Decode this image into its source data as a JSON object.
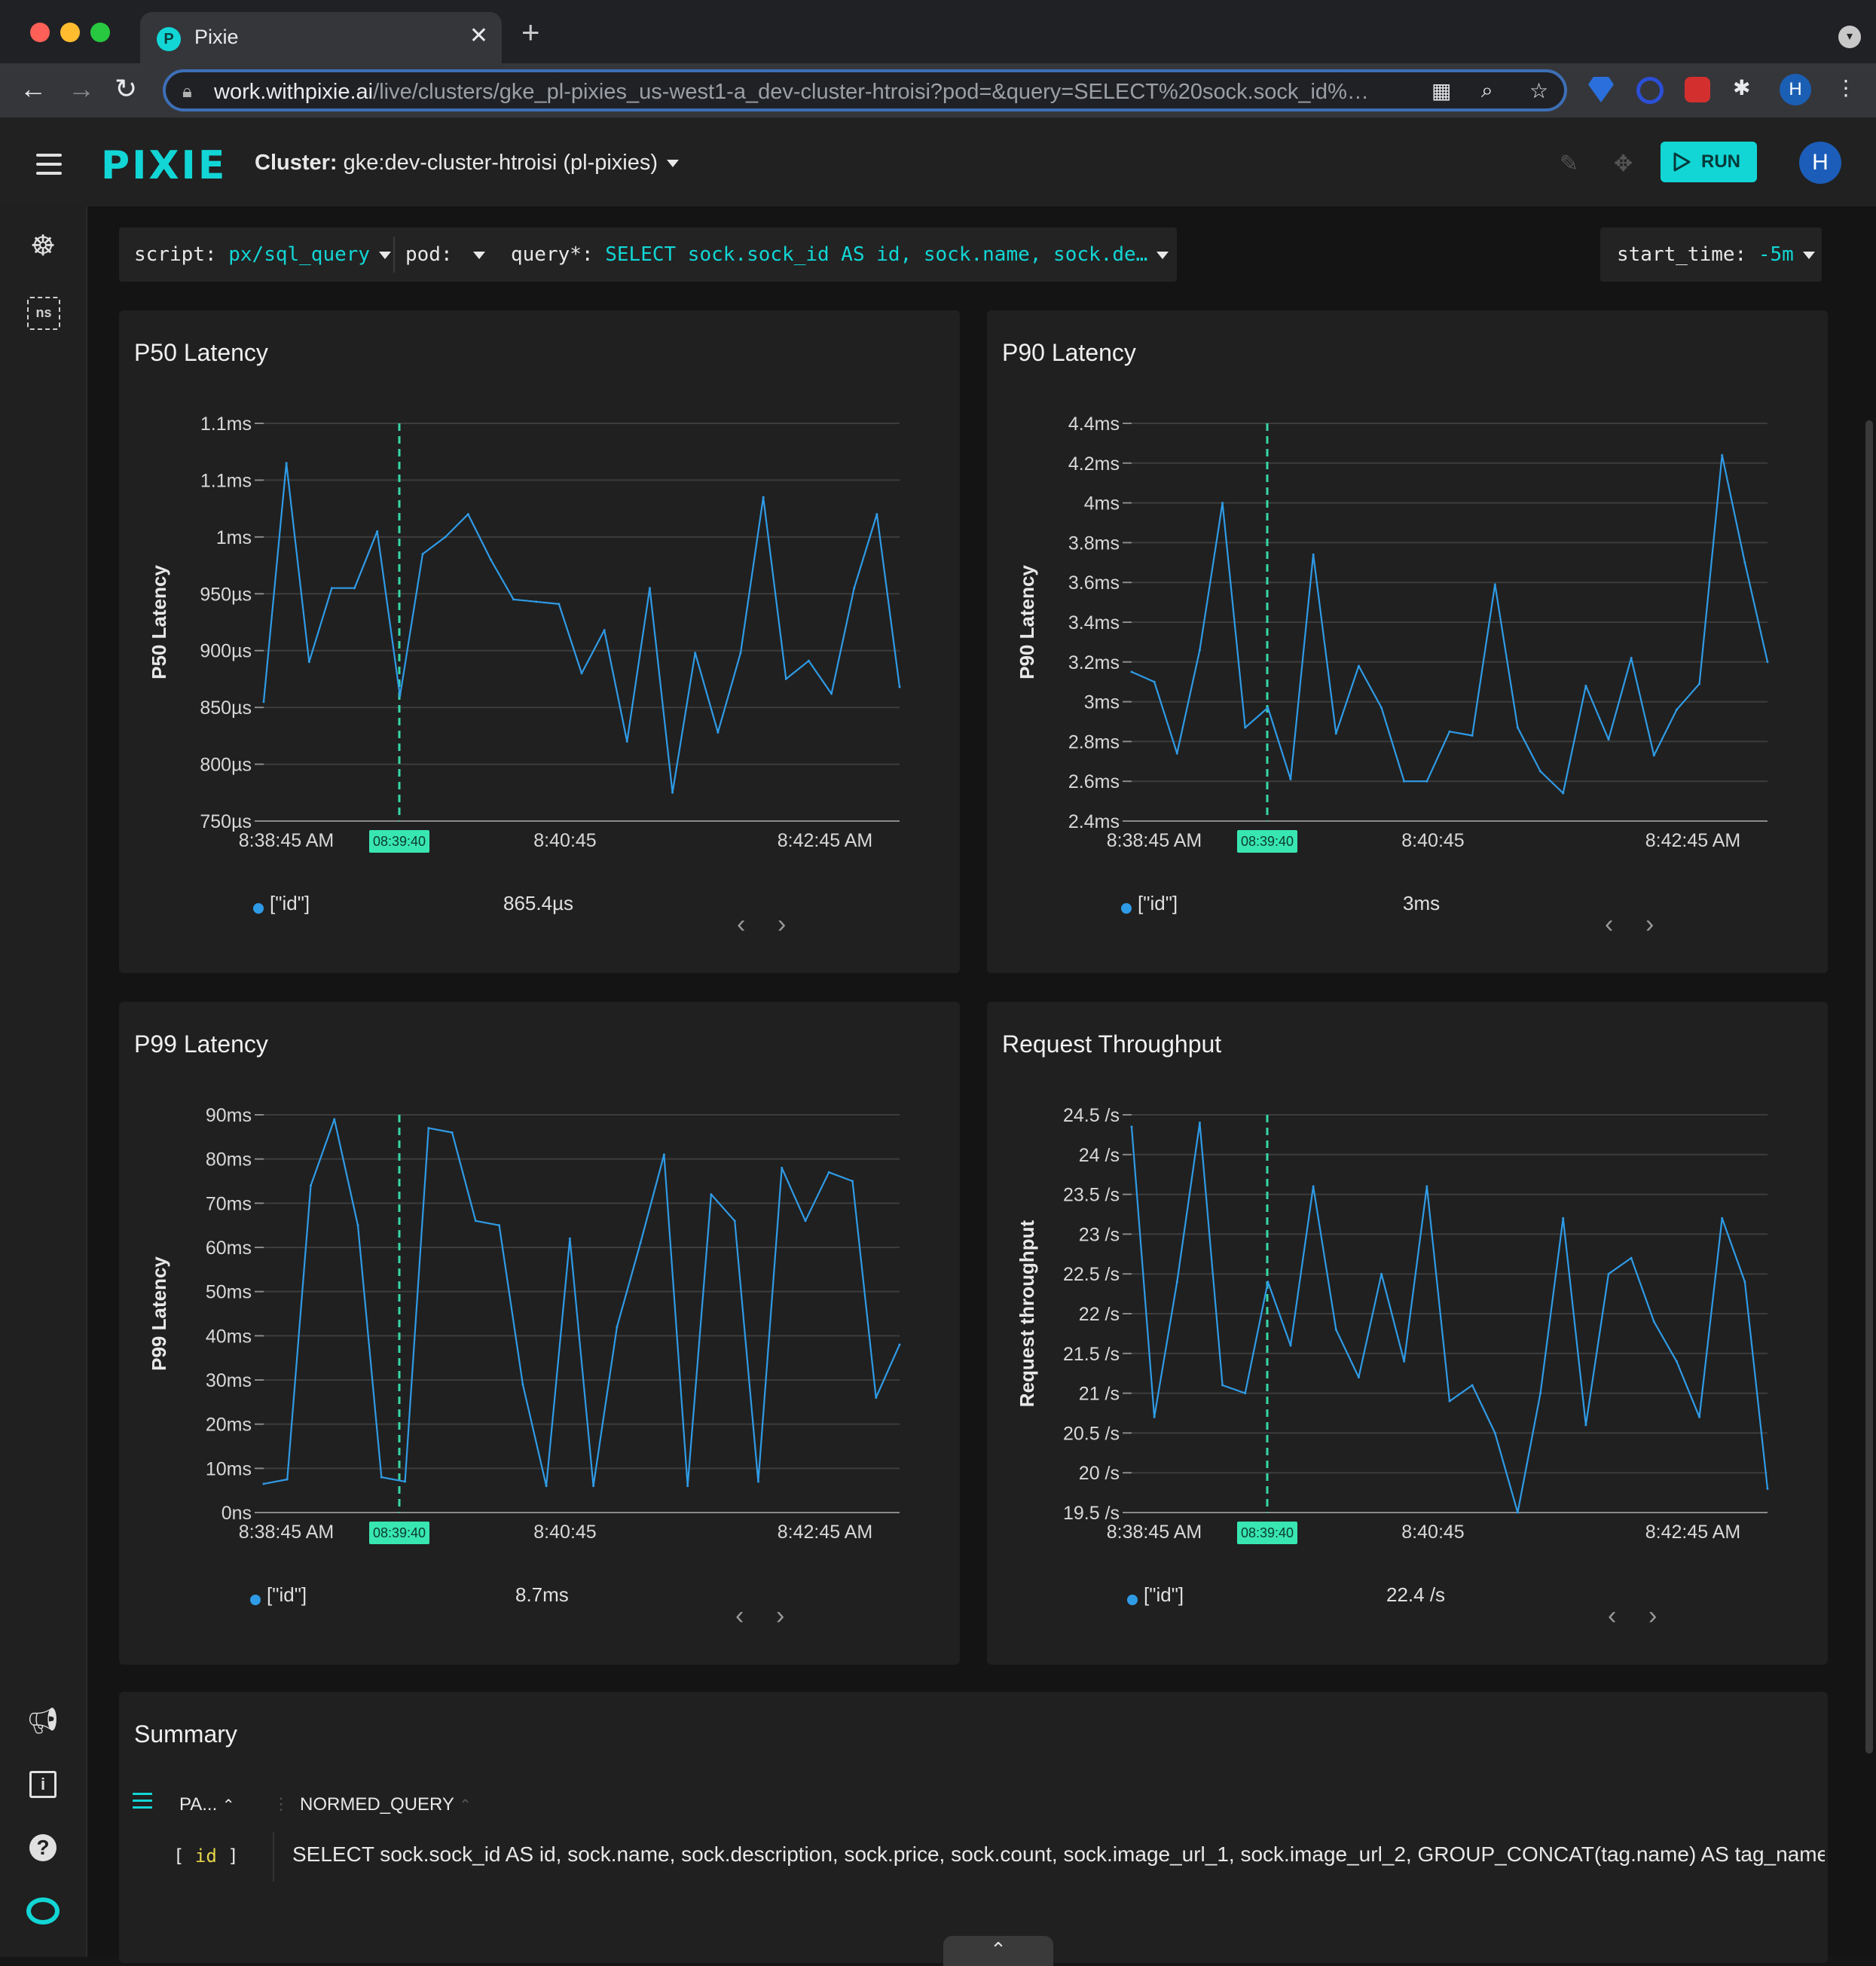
{
  "browser": {
    "tab_title": "Pixie",
    "url_host": "work.withpixie.ai",
    "url_rest": "/live/clusters/gke_pl-pixies_us-west1-a_dev-cluster-htroisi?pod=&query=SELECT%20sock.sock_id%…",
    "profile_initial": "H"
  },
  "header": {
    "logo": "PIXIE",
    "cluster_label": "Cluster:",
    "cluster_value": "gke:dev-cluster-htroisi (pl-pixies)",
    "run_label": "RUN",
    "avatar_initial": "H"
  },
  "sidebar": {
    "ns_label": "ns"
  },
  "vars": {
    "script_label": "script:",
    "script_value": "px/sql_query",
    "pod_label": "pod:",
    "pod_value": "",
    "query_label": "query*:",
    "query_value": "SELECT sock.sock_id AS id, sock.name, sock.de…",
    "start_label": "start_time:",
    "start_value": "-5m"
  },
  "colors": {
    "accent": "#12d6d6",
    "series": "#2f9be6",
    "cursor": "#37d6a6"
  },
  "panels": [
    {
      "title": "P50 Latency",
      "ylabel": "P50 Latency",
      "yticks": [
        "1.1ms",
        "1.1ms",
        "1ms",
        "950µs",
        "900µs",
        "850µs",
        "800µs",
        "750µs"
      ],
      "xticks": [
        "8:38:45 AM",
        "8:40:45",
        "8:42:45 AM"
      ],
      "cursor_label": "08:39:40",
      "legend_label": "[\"id\"]",
      "legend_value": "865.4µs"
    },
    {
      "title": "P90 Latency",
      "ylabel": "P90 Latency",
      "yticks": [
        "4.4ms",
        "4.2ms",
        "4ms",
        "3.8ms",
        "3.6ms",
        "3.4ms",
        "3.2ms",
        "3ms",
        "2.8ms",
        "2.6ms",
        "2.4ms"
      ],
      "xticks": [
        "8:38:45 AM",
        "8:40:45",
        "8:42:45 AM"
      ],
      "cursor_label": "08:39:40",
      "legend_label": "[\"id\"]",
      "legend_value": "3ms"
    },
    {
      "title": "P99 Latency",
      "ylabel": "P99 Latency",
      "yticks": [
        "90ms",
        "80ms",
        "70ms",
        "60ms",
        "50ms",
        "40ms",
        "30ms",
        "20ms",
        "10ms",
        "0ns"
      ],
      "xticks": [
        "8:38:45 AM",
        "8:40:45",
        "8:42:45 AM"
      ],
      "cursor_label": "08:39:40",
      "legend_label": "[\"id\"]",
      "legend_value": "8.7ms"
    },
    {
      "title": "Request Throughput",
      "ylabel": "Request throughput",
      "yticks": [
        "24.5 /s",
        "24 /s",
        "23.5 /s",
        "23 /s",
        "22.5 /s",
        "22 /s",
        "21.5 /s",
        "21 /s",
        "20.5 /s",
        "20 /s",
        "19.5 /s"
      ],
      "xticks": [
        "8:38:45 AM",
        "8:40:45",
        "8:42:45 AM"
      ],
      "cursor_label": "08:39:40",
      "legend_label": "[\"id\"]",
      "legend_value": "22.4 /s"
    }
  ],
  "chart_data": [
    {
      "type": "line",
      "title": "P50 Latency",
      "ylabel": "P50 Latency",
      "unit": "µs",
      "ylim": [
        750,
        1100
      ],
      "x_start": "8:38:45 AM",
      "x_mid": "8:40:45",
      "x_end": "8:42:45 AM",
      "cursor": "08:39:40",
      "series": [
        {
          "values": [
            855,
            1065,
            890,
            955,
            955,
            1005,
            860,
            985,
            1000,
            1020,
            980,
            945,
            943,
            941,
            880,
            918,
            820,
            955,
            775,
            898,
            828,
            898,
            1035,
            875,
            891,
            862,
            955,
            1020,
            868
          ]
        }
      ]
    },
    {
      "type": "line",
      "title": "P90 Latency",
      "ylabel": "P90 Latency",
      "unit": "ms",
      "ylim": [
        2.4,
        4.4
      ],
      "x_start": "8:38:45 AM",
      "x_mid": "8:40:45",
      "x_end": "8:42:45 AM",
      "cursor": "08:39:40",
      "series": [
        {
          "values": [
            3.15,
            3.1,
            2.74,
            3.26,
            4.0,
            2.87,
            2.97,
            2.61,
            3.74,
            2.84,
            3.18,
            2.97,
            2.6,
            2.6,
            2.85,
            2.83,
            3.59,
            2.87,
            2.65,
            2.54,
            3.08,
            2.81,
            3.22,
            2.73,
            2.96,
            3.09,
            4.24,
            3.7,
            3.2
          ]
        }
      ]
    },
    {
      "type": "line",
      "title": "P99 Latency",
      "ylabel": "P99 Latency",
      "unit": "ms",
      "ylim": [
        0,
        90
      ],
      "x_start": "8:38:45 AM",
      "x_mid": "8:40:45",
      "x_end": "8:42:45 AM",
      "cursor": "08:39:40",
      "series": [
        {
          "values": [
            6.5,
            7.5,
            74,
            89,
            65,
            8,
            7,
            87,
            86,
            66,
            65,
            29,
            6,
            62,
            6,
            42,
            61,
            81,
            6,
            72,
            66,
            7,
            78,
            66,
            77,
            75,
            26,
            38
          ]
        }
      ]
    },
    {
      "type": "line",
      "title": "Request Throughput",
      "ylabel": "Request throughput",
      "unit": "/s",
      "ylim": [
        19.5,
        24.5
      ],
      "x_start": "8:38:45 AM",
      "x_mid": "8:40:45",
      "x_end": "8:42:45 AM",
      "cursor": "08:39:40",
      "series": [
        {
          "values": [
            24.35,
            20.7,
            22.4,
            24.4,
            21.1,
            21.0,
            22.4,
            21.6,
            23.6,
            21.8,
            21.2,
            22.5,
            21.4,
            23.6,
            20.9,
            21.1,
            20.5,
            19.5,
            21.0,
            23.2,
            20.6,
            22.5,
            22.7,
            21.9,
            21.4,
            20.7,
            23.2,
            22.4,
            19.8
          ]
        }
      ]
    }
  ],
  "summary": {
    "title": "Summary",
    "col1_header": "PA...",
    "col2_header": "NORMED_QUERY",
    "row_bracket_open": "[",
    "row_id": "id",
    "row_bracket_close": "]",
    "row_query": "SELECT sock.sock_id AS id, sock.name, sock.description, sock.price, sock.count, sock.image_url_1, sock.image_url_2, GROUP_CONCAT(tag.name) AS tag_name"
  }
}
